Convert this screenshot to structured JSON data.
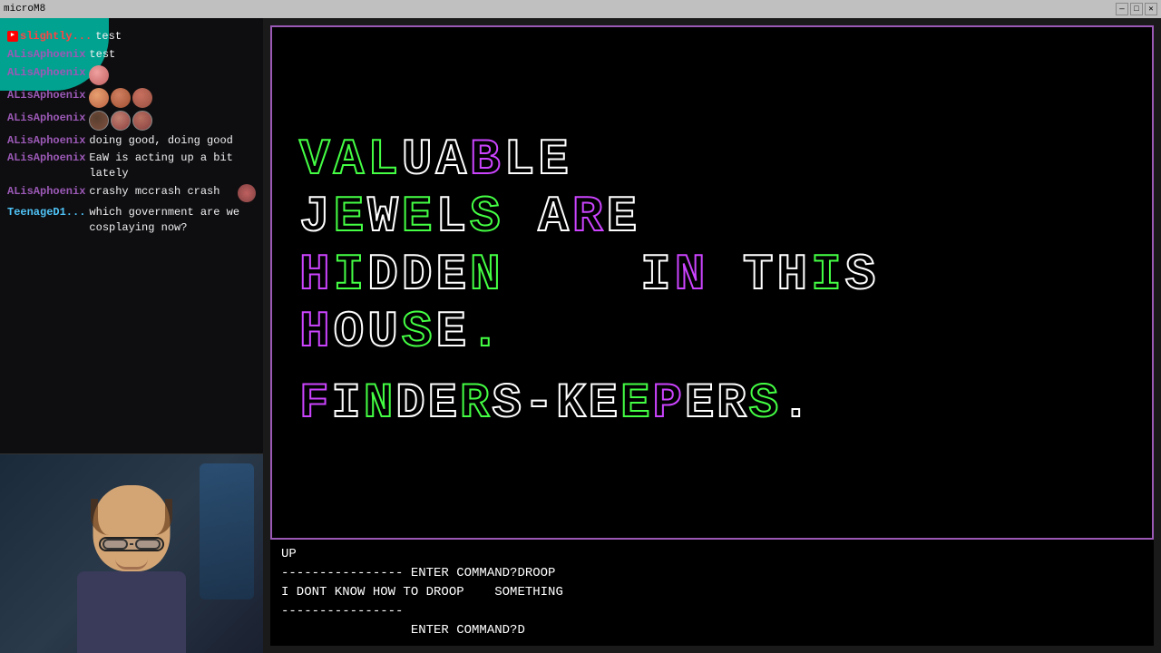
{
  "titlebar": {
    "title": "microM8",
    "minimize": "—",
    "maximize": "□",
    "close": "✕"
  },
  "chat": {
    "messages": [
      {
        "username": "slightly...",
        "type": "slightly",
        "text": "test",
        "hasLiveDot": true
      },
      {
        "username": "ALisAphoenix",
        "type": "alisaphoenix",
        "text": "test"
      },
      {
        "username": "ALisAphoenix",
        "type": "alisaphoenix",
        "text": "",
        "emotes": [
          "face1"
        ]
      },
      {
        "username": "ALisAphoenix",
        "type": "alisaphoenix",
        "text": "",
        "emotes": [
          "face1",
          "face2",
          "face3"
        ]
      },
      {
        "username": "ALisAphoenix",
        "type": "alisaphoenix",
        "text": "",
        "emotes": [
          "face4",
          "face5",
          "face6"
        ]
      },
      {
        "username": "ALisAphoenix",
        "type": "alisaphoenix",
        "text": "doing good, doing good"
      },
      {
        "username": "ALisAphoenix",
        "type": "alisaphoenix",
        "text": "EaW is acting up a bit lately"
      },
      {
        "username": "ALisAphoenix",
        "type": "alisaphoenix",
        "text": "crashy mccrash crash",
        "emotes": [
          "crash"
        ]
      },
      {
        "username": "TeenageD1...",
        "type": "teenaged",
        "text": "which government are we cosplaying now?"
      }
    ]
  },
  "game": {
    "lines": [
      "VALUABLE",
      "JEWELS ARE",
      "HIDDEN    IN THIS",
      "HOUSE.",
      "",
      "FINDERS-KEEPERS."
    ],
    "terminal": [
      "UP",
      "---------------- ENTER COMMAND?DROOP",
      "I DONT KNOW HOW TO DROOP    SOMETHING",
      "----------------",
      "                 ENTER COMMAND?D"
    ]
  }
}
